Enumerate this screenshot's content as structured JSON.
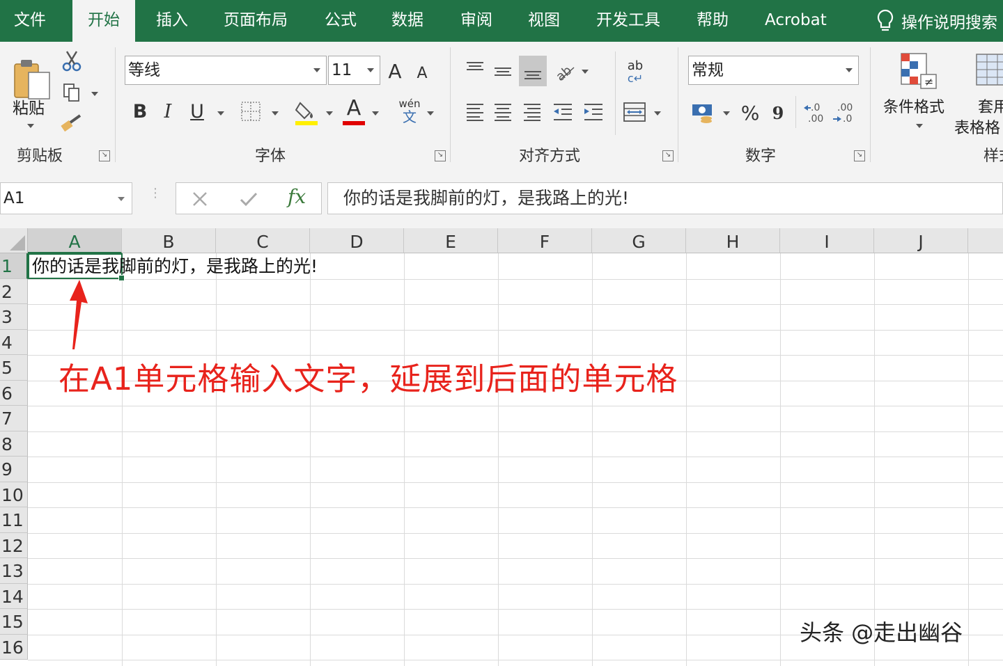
{
  "tabs": {
    "file": "文件",
    "home": "开始",
    "insert": "插入",
    "page_layout": "页面布局",
    "formulas": "公式",
    "data": "数据",
    "review": "审阅",
    "view": "视图",
    "developer": "开发工具",
    "help": "帮助",
    "acrobat": "Acrobat",
    "search": "操作说明搜索"
  },
  "ribbon": {
    "clipboard": {
      "paste_label": "粘贴",
      "group_label": "剪贴板"
    },
    "font": {
      "font_name": "等线",
      "font_size": "11",
      "bold": "B",
      "italic": "I",
      "underline": "U",
      "pinyin": "wén",
      "pinyin_char": "文",
      "grow": "A",
      "shrink": "A",
      "font_color_glyph": "A",
      "group_label": "字体"
    },
    "alignment": {
      "wrap_glyph": "ab",
      "group_label": "对齐方式"
    },
    "number": {
      "format": "常规",
      "percent": "%",
      "comma": "9",
      "group_label": "数字"
    },
    "styles": {
      "conditional_format": "条件格式",
      "table_format_1": "套用",
      "table_format_2": "表格格",
      "group_label": "样式"
    }
  },
  "formula_bar": {
    "name_box": "A1",
    "fx": "fx",
    "formula": "你的话是我脚前的灯，是我路上的光!"
  },
  "sheet": {
    "columns": [
      "A",
      "B",
      "C",
      "D",
      "E",
      "F",
      "G",
      "H",
      "I",
      "J"
    ],
    "rows": [
      "1",
      "2",
      "3",
      "4",
      "5",
      "6",
      "7",
      "8",
      "9",
      "10",
      "11",
      "12",
      "13",
      "14",
      "15",
      "16"
    ],
    "active_cell": "A1",
    "cell_a1": "你的话是我脚前的灯，是我路上的光!"
  },
  "annotation": {
    "text": "在A1单元格输入文字，延展到后面的单元格",
    "color": "#e8231c"
  },
  "watermark": "头条 @走出幽谷",
  "colors": {
    "accent": "#217346",
    "ribbon_bg": "#f3f3f3"
  }
}
